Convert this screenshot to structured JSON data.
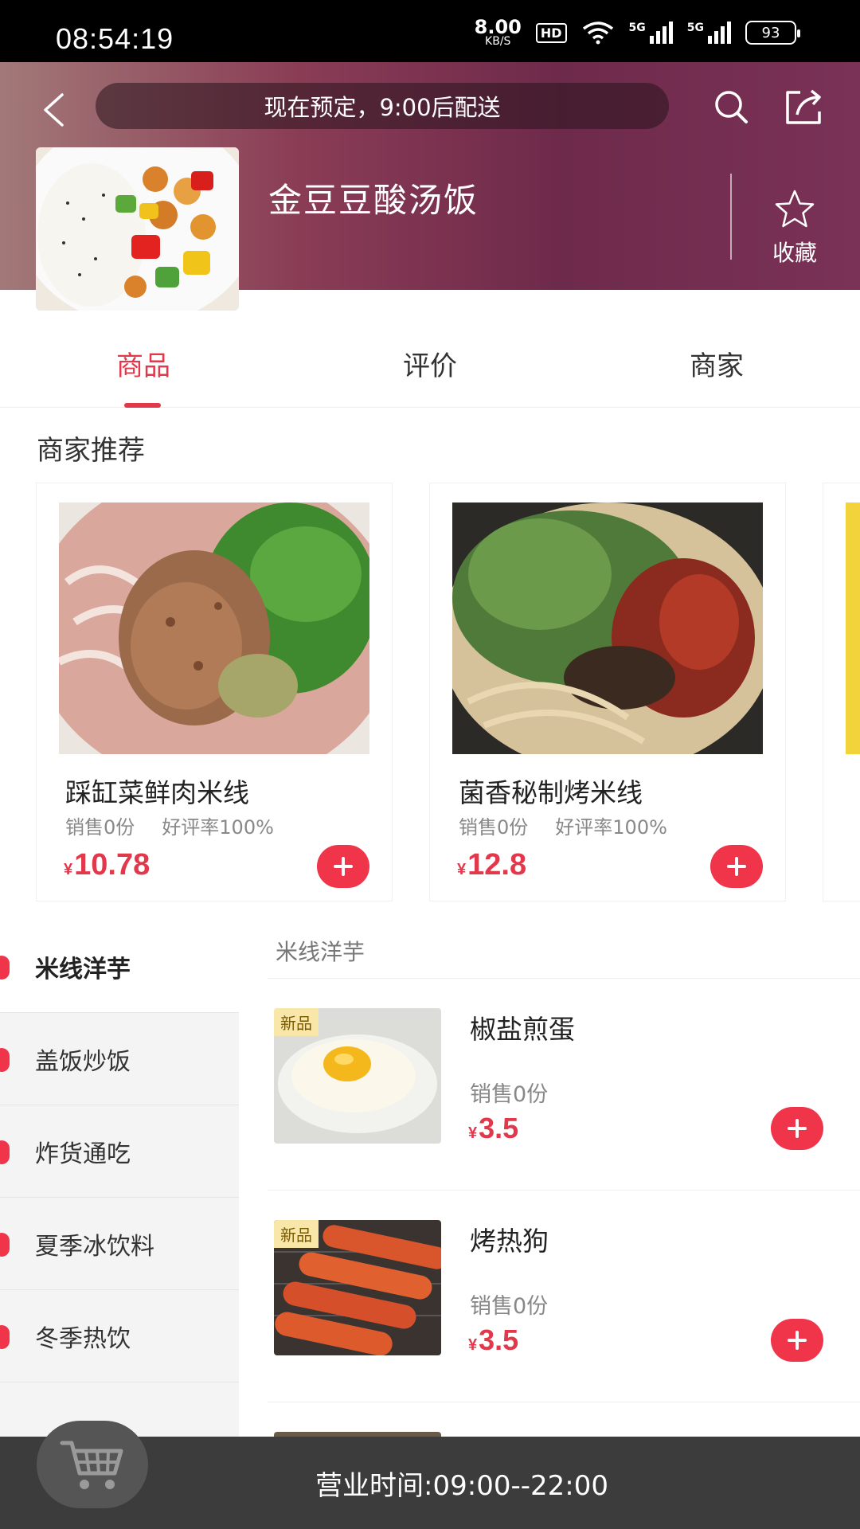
{
  "status_bar": {
    "time": "08:54:19",
    "net_speed_value": "8.00",
    "net_speed_unit": "KB/S",
    "hd_badge": "HD",
    "signal_1_label": "5G",
    "signal_2_label": "5G",
    "battery": "93"
  },
  "header": {
    "notice": "现在预定，9:00后配送",
    "store_name": "金豆豆酸汤饭",
    "favorite_label": "收藏"
  },
  "tabs": [
    {
      "label": "商品",
      "active": true
    },
    {
      "label": "评价",
      "active": false
    },
    {
      "label": "商家",
      "active": false
    }
  ],
  "recommend": {
    "title": "商家推荐",
    "items": [
      {
        "name": "踩缸菜鲜肉米线",
        "sales": "销售0份",
        "rating": "好评率100%",
        "currency": "¥",
        "price": "10.78"
      },
      {
        "name": "菌香秘制烤米线",
        "sales": "销售0份",
        "rating": "好评率100%",
        "currency": "¥",
        "price": "12.8"
      }
    ]
  },
  "categories": [
    {
      "label": "米线洋芋",
      "active": true
    },
    {
      "label": "盖饭炒饭",
      "active": false
    },
    {
      "label": "炸货通吃",
      "active": false
    },
    {
      "label": "夏季冰饮料",
      "active": false
    },
    {
      "label": "冬季热饮",
      "active": false
    }
  ],
  "product_list": {
    "section_title": "米线洋芋",
    "items": [
      {
        "badge": "新品",
        "name": "椒盐煎蛋",
        "sales": "销售0份",
        "currency": "¥",
        "price": "3.5"
      },
      {
        "badge": "新品",
        "name": "烤热狗",
        "sales": "销售0份",
        "currency": "¥",
        "price": "3.5"
      }
    ]
  },
  "bottom_bar": {
    "business_hours": "营业时间:09:00--22:00"
  },
  "colors": {
    "accent": "#e2384b",
    "add_button": "#f0344a",
    "bottom_bar": "#3c3c3c"
  },
  "icons": [
    "back-arrow-icon",
    "search-icon",
    "share-icon",
    "star-icon",
    "plus-icon",
    "cart-icon"
  ]
}
